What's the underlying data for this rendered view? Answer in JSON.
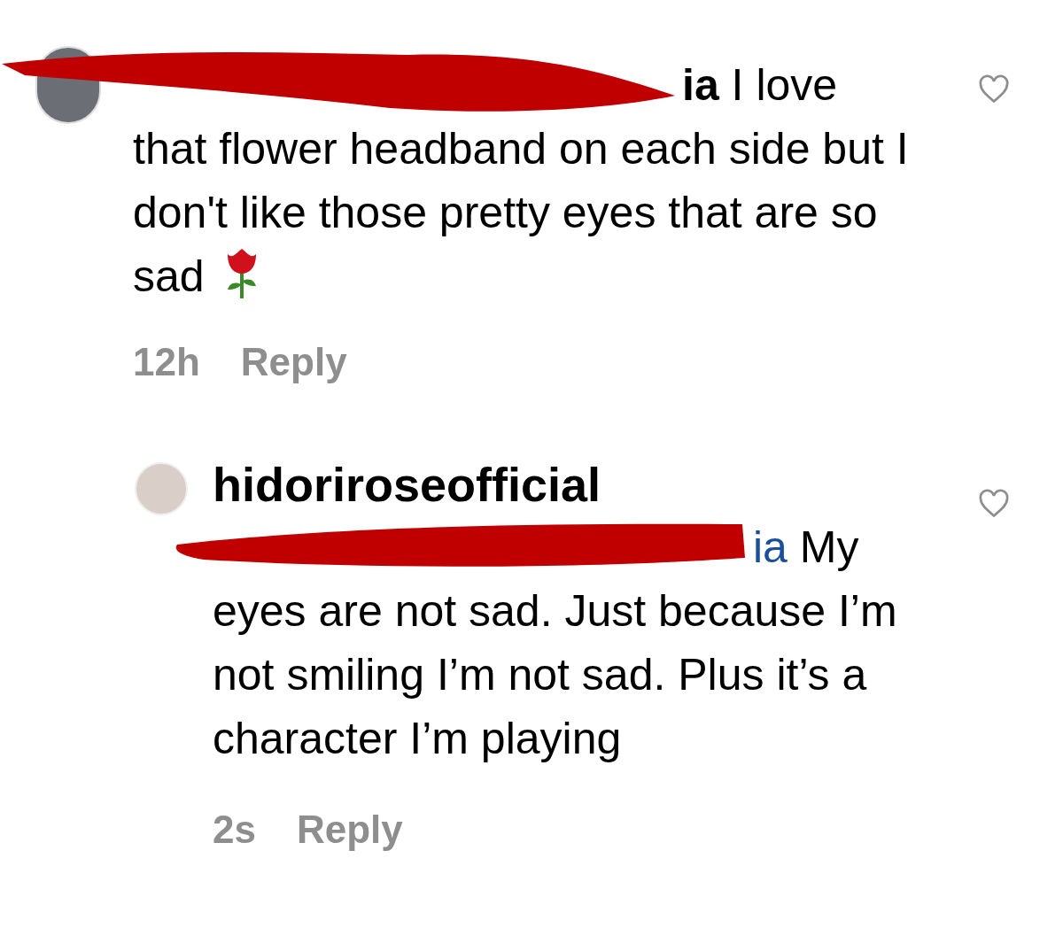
{
  "comments": [
    {
      "username_visible": "ia",
      "text": "I love that flower headband on each side but I don't like those pretty eyes that are so sad",
      "time": "12h",
      "reply": "Reply",
      "liked": false,
      "redacted": true
    },
    {
      "username_visible": "hidoriroseofficial",
      "mention_visible": "ia",
      "text": "My eyes are not sad. Just because I’m not smiling I’m not sad. Plus it’s a character I’m playing",
      "time": "2s",
      "reply": "Reply",
      "liked": false,
      "redacted": true
    }
  ]
}
